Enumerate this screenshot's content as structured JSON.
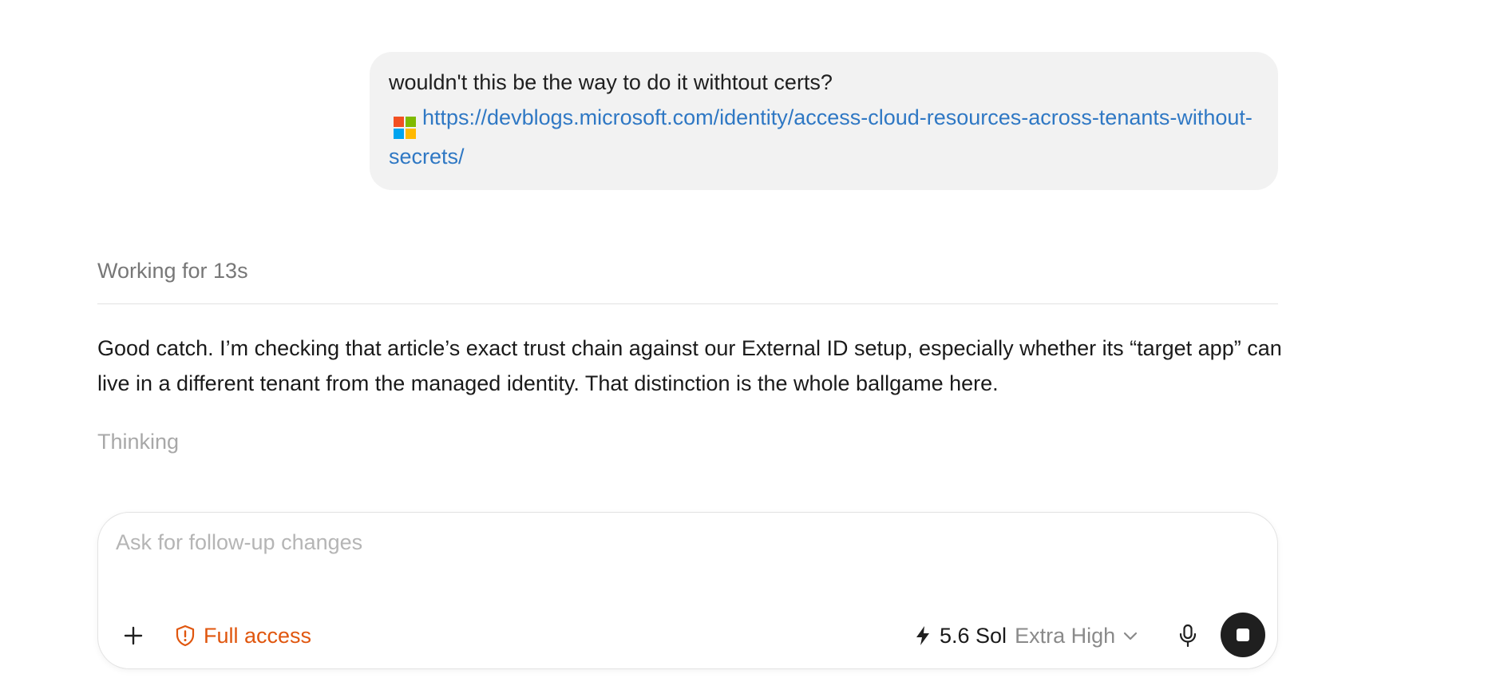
{
  "conversation": {
    "user_message": {
      "text": "wouldn't this be the way to do it withtout certs?",
      "link_text": "https://devblogs.microsoft.com/identity/access-cloud-resources-across-tenants-without-secrets/",
      "link_icon": "microsoft-logo-icon"
    },
    "status": "Working for 13s",
    "assistant_message": "Good catch. I’m checking that article’s exact trust chain against our External ID setup, especially whether its “target app” can live in a different tenant from the managed identity. That distinction is the whole ballgame here.",
    "thinking_label": "Thinking"
  },
  "composer": {
    "placeholder": "Ask for follow-up changes",
    "value": "",
    "add_icon": "plus-icon",
    "access_label": "Full access",
    "access_icon": "shield-alert-icon",
    "model_icon": "lightning-bolt-icon",
    "model_name": "5.6 Sol",
    "reasoning_level": "Extra High",
    "dropdown_icon": "chevron-down-icon",
    "mic_icon": "microphone-icon",
    "stop_icon": "stop-icon"
  },
  "colors": {
    "link": "#2f78c4",
    "access": "#e0560e",
    "bubble_bg": "#f2f2f2",
    "stop_button_bg": "#1f1f1f",
    "muted_text": "#777777"
  }
}
